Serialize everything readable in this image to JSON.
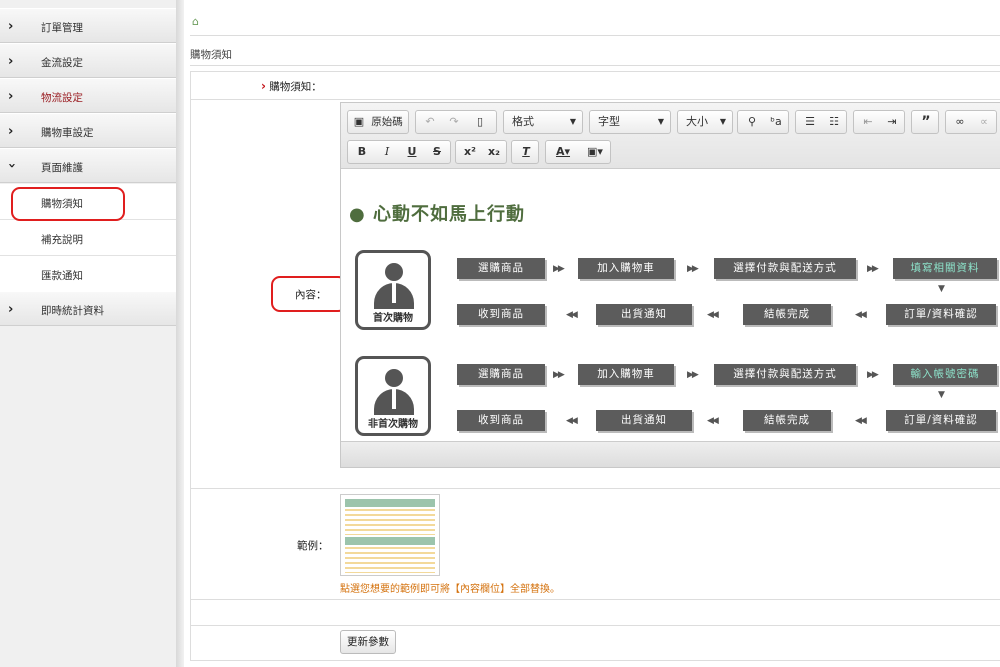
{
  "sidebar": {
    "items": [
      {
        "label": "訂單管理"
      },
      {
        "label": "金流設定"
      },
      {
        "label": "物流設定"
      },
      {
        "label": "購物車設定"
      },
      {
        "label": "頁面維護"
      },
      {
        "label": "即時統計資料"
      }
    ],
    "subitems": [
      {
        "label": "購物須知"
      },
      {
        "label": "補充說明"
      },
      {
        "label": "匯款通知"
      }
    ]
  },
  "breadcrumb": {
    "title": "購物須知"
  },
  "form": {
    "header_label": "購物須知：",
    "content_label": "內容：",
    "example_label": "範例：",
    "hint": "點選您想要的範例即可將【內容欄位】全部替換。",
    "update_button": "更新參數"
  },
  "toolbar": {
    "source_label": "原始碼",
    "format_label": "格式",
    "font_label": "字型",
    "size_label": "大小"
  },
  "flow": {
    "title": "心動不如馬上行動",
    "first": {
      "label": "首次購物",
      "row1": [
        "選購商品",
        "加入購物車",
        "選擇付款與配送方式",
        "填寫相關資料"
      ],
      "row2": [
        "收到商品",
        "出貨通知",
        "結帳完成",
        "訂單/資料確認"
      ]
    },
    "repeat": {
      "label": "非首次購物",
      "row1": [
        "選購商品",
        "加入購物車",
        "選擇付款與配送方式",
        "輸入帳號密碼"
      ],
      "row2": [
        "收到商品",
        "出貨通知",
        "結帳完成",
        "訂單/資料確認"
      ]
    }
  },
  "colors": {
    "accent_red": "#9b1f24",
    "flow_green": "#4f6d3e",
    "step_bg": "#5c5c5c",
    "highlight": "#e01e1e",
    "hint_orange": "#d4720e"
  },
  "icons": [
    "chevron-right-icon",
    "chevron-down-icon",
    "home-icon",
    "person-icon"
  ]
}
